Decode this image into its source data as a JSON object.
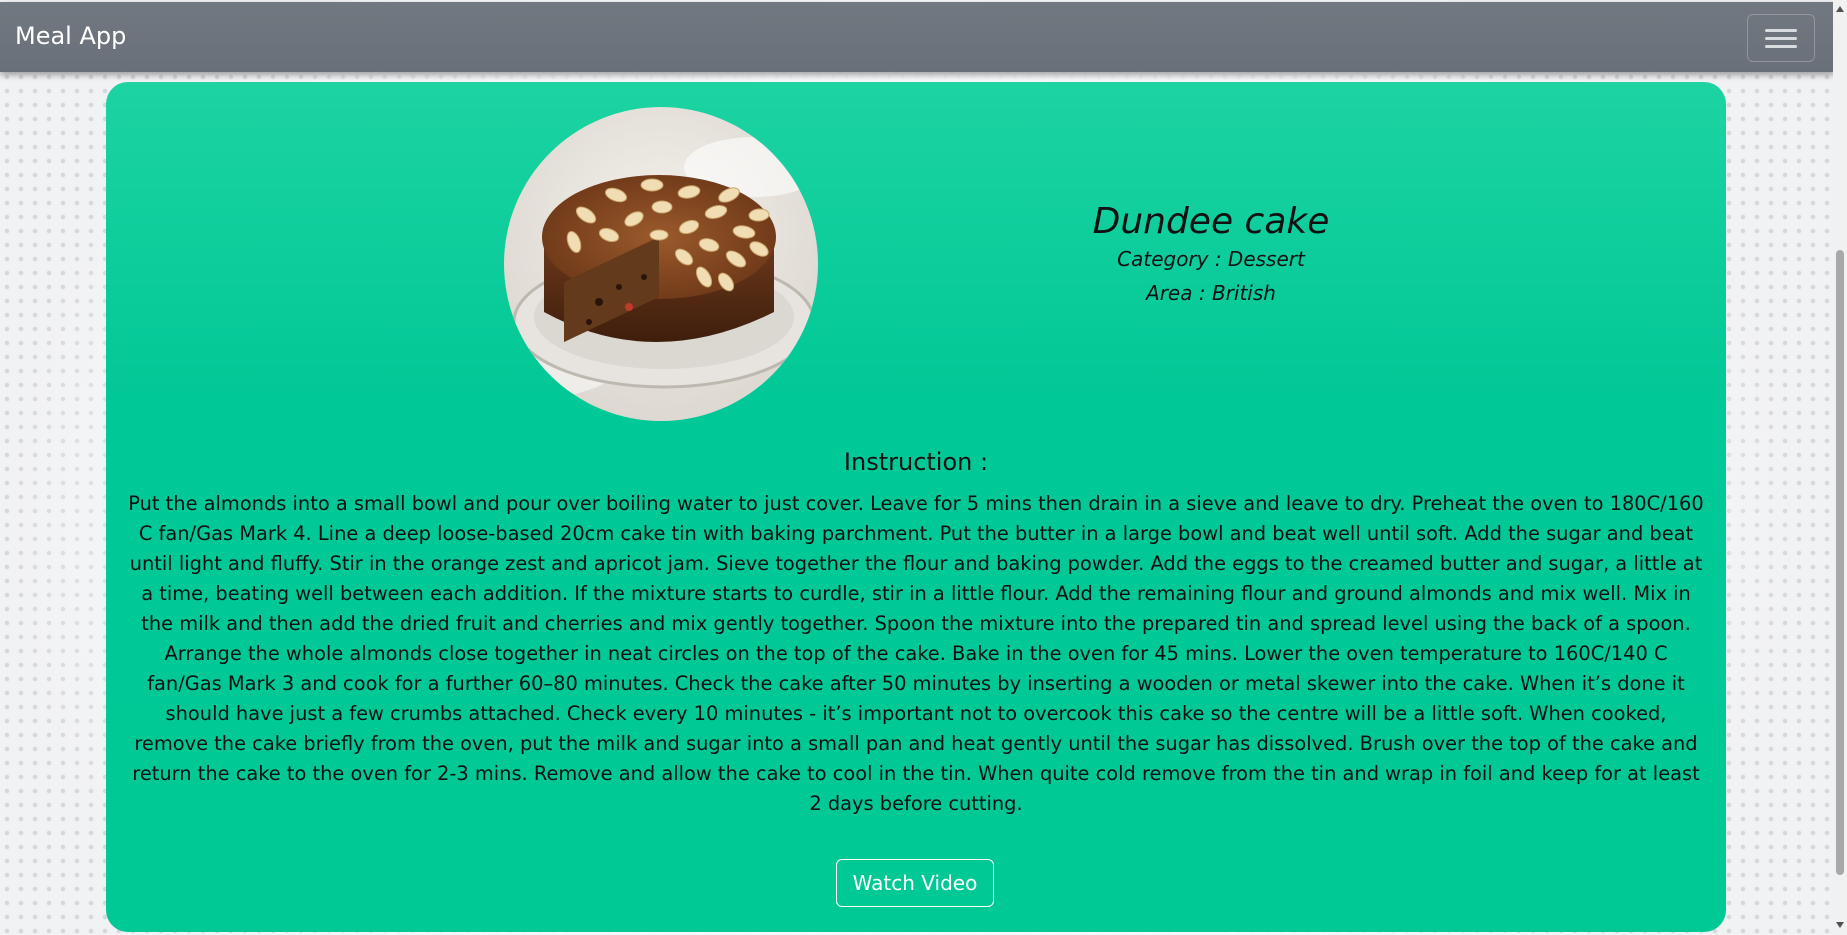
{
  "navbar": {
    "brand": "Meal App",
    "menu_icon": "hamburger-menu-icon"
  },
  "meal": {
    "image_alt": "Dundee cake",
    "title": "Dundee cake",
    "category": "Category : Dessert",
    "area": "Area : British",
    "instruction_heading": "Instruction :",
    "instructions": "Put the almonds into a small bowl and pour over boiling water to just cover. Leave for 5 mins then drain in a sieve and leave to dry. Preheat the oven to 180C/160 C fan/Gas Mark 4. Line a deep loose-based 20cm cake tin with baking parchment. Put the butter in a large bowl and beat well until soft. Add the sugar and beat until light and fluffy. Stir in the orange zest and apricot jam. Sieve together the flour and baking powder. Add the eggs to the creamed butter and sugar, a little at a time, beating well between each addition. If the mixture starts to curdle, stir in a little flour. Add the remaining flour and ground almonds and mix well. Mix in the milk and then add the dried fruit and cherries and mix gently together. Spoon the mixture into the prepared tin and spread level using the back of a spoon. Arrange the whole almonds close together in neat circles on the top of the cake. Bake in the oven for 45 mins. Lower the oven temperature to 160C/140 C fan/Gas Mark 3 and cook for a further 60–80 minutes. Check the cake after 50 minutes by inserting a wooden or metal skewer into the cake. When it’s done it should have just a few crumbs attached. Check every 10 minutes - it’s important not to overcook this cake so the centre will be a little soft. When cooked, remove the cake briefly from the oven, put the milk and sugar into a small pan and heat gently until the sugar has dissolved. Brush over the top of the cake and return the cake to the oven for 2-3 mins. Remove and allow the cake to cool in the tin. When quite cold remove from the tin and wrap in foil and keep for at least 2 days before cutting.",
    "watch_video_label": "Watch Video"
  },
  "colors": {
    "navbar": "#6c737c",
    "card": "#00c896",
    "button_border": "#ffffff"
  }
}
